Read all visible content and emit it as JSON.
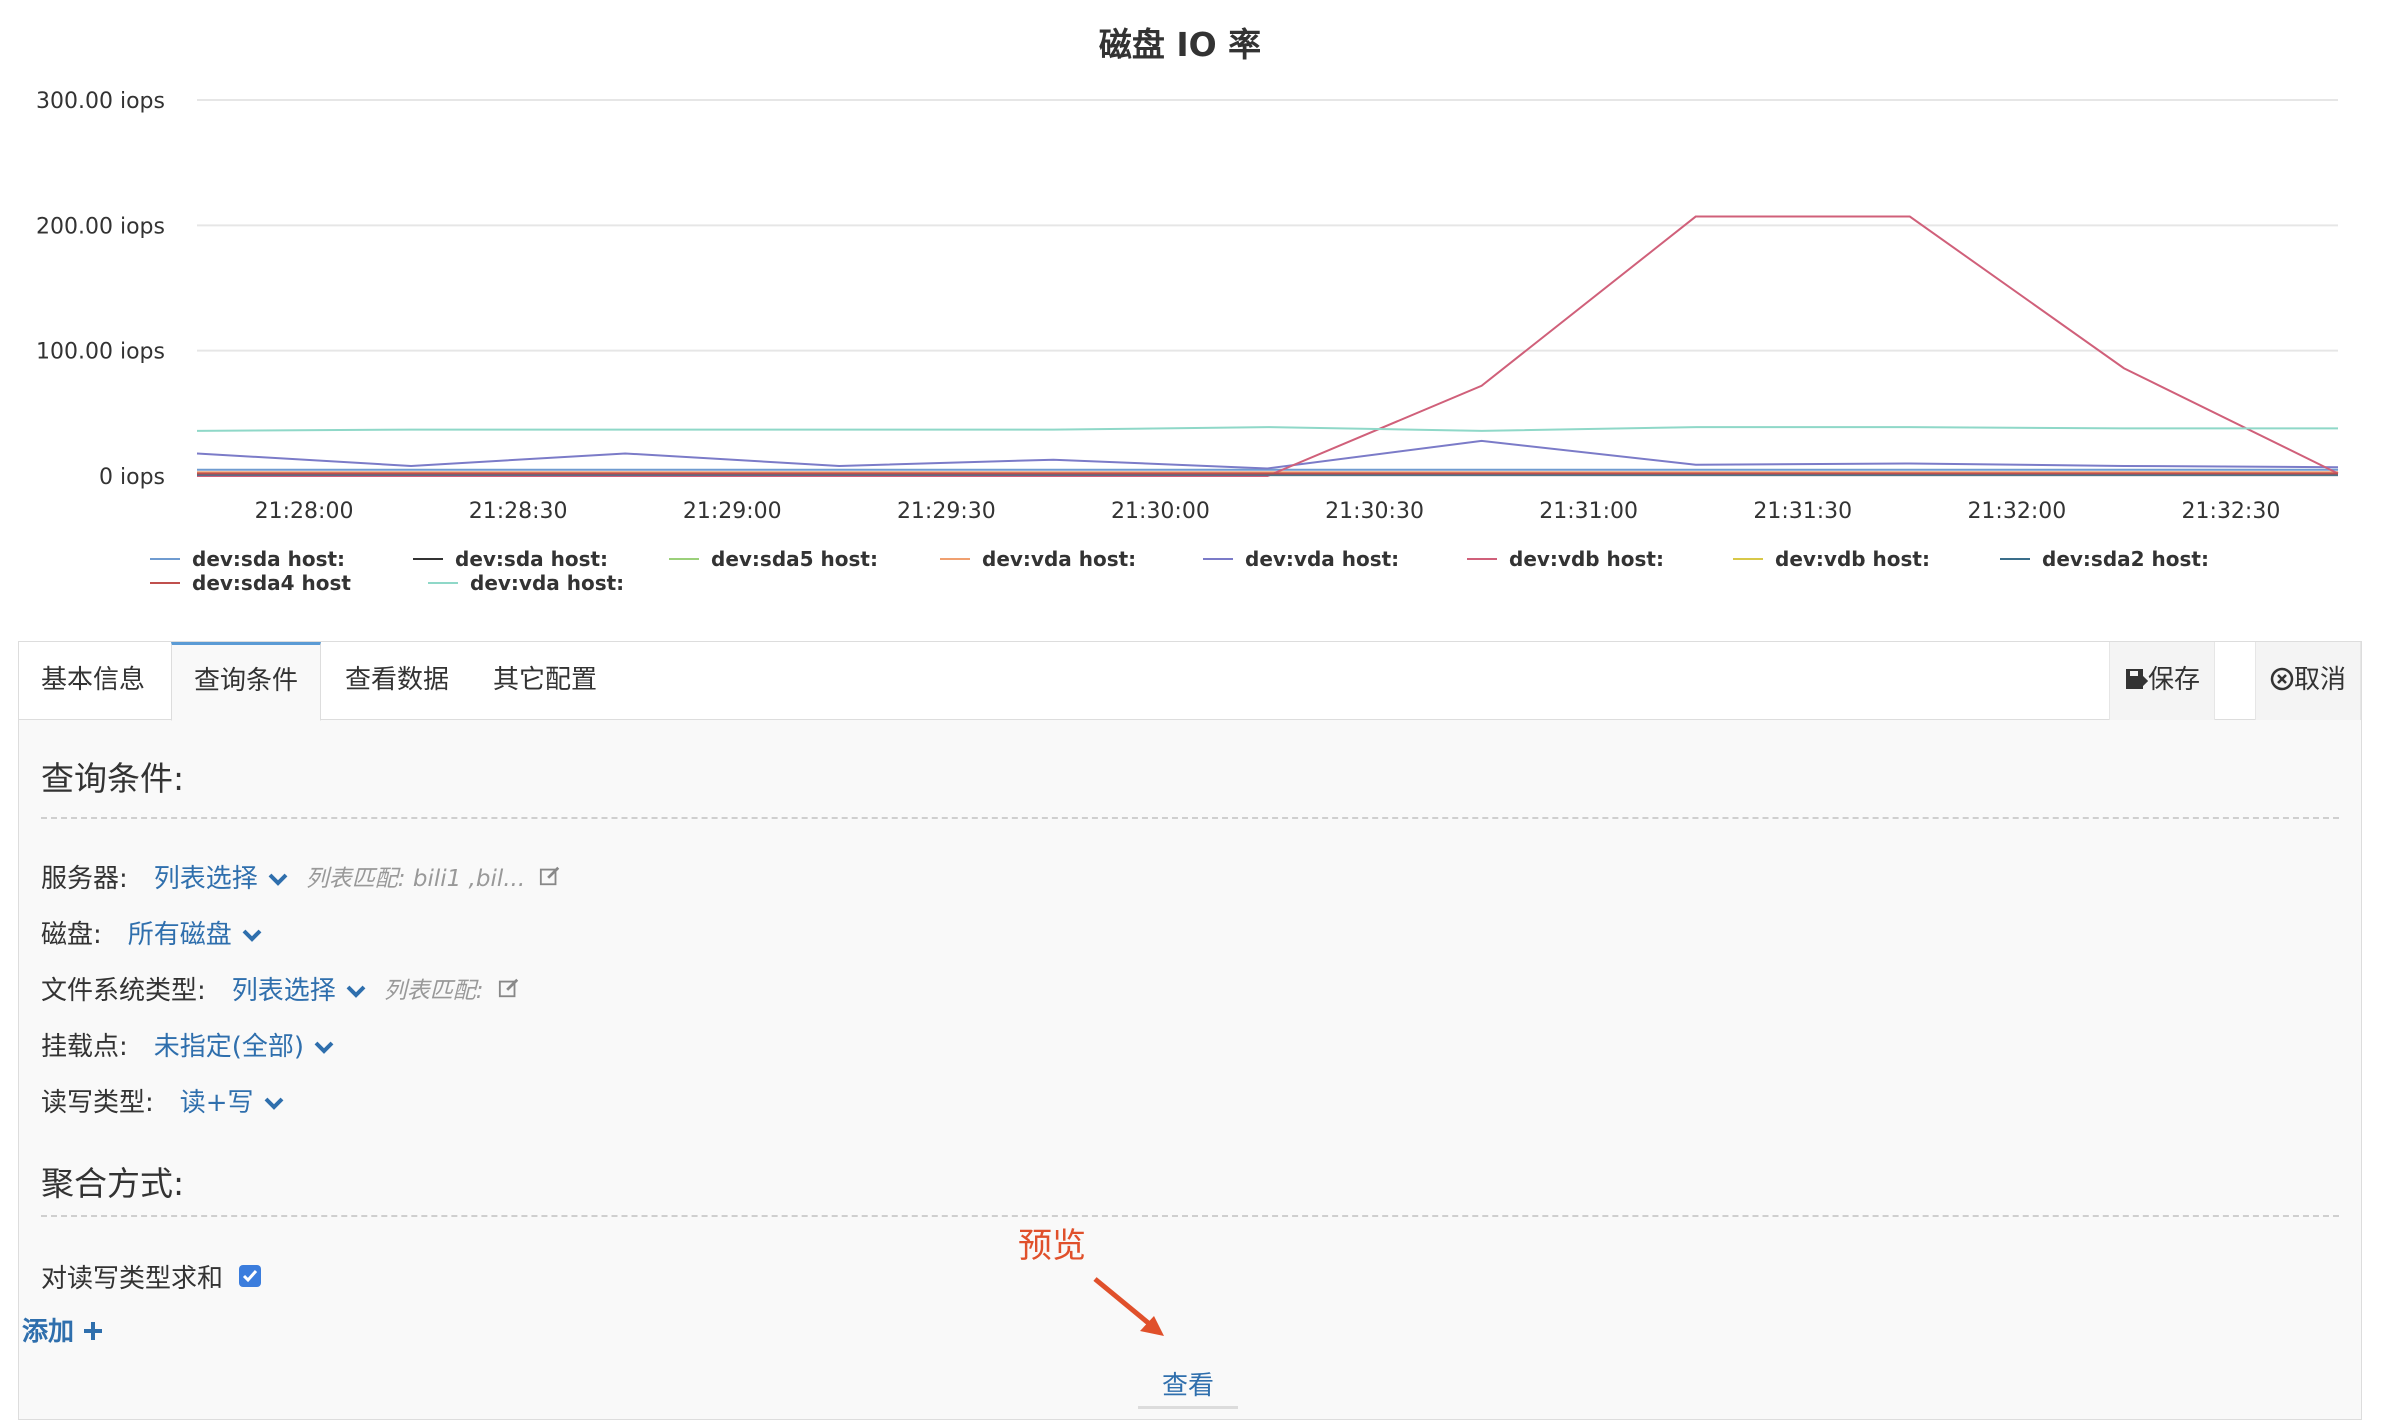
{
  "chart_title": "磁盘 IO 率",
  "chart_data": {
    "type": "line",
    "title": "磁盘 IO 率",
    "ylim": [
      0,
      300
    ],
    "y_ticks": [
      "300.00 iops",
      "200.00 iops",
      "100.00 iops",
      "0 iops"
    ],
    "x": [
      "21:27:45",
      "21:28:15",
      "21:28:45",
      "21:29:15",
      "21:29:45",
      "21:30:15",
      "21:30:45",
      "21:31:15",
      "21:31:45",
      "21:32:15",
      "21:32:45"
    ],
    "x_ticks": [
      "21:28:00",
      "21:28:30",
      "21:29:00",
      "21:29:30",
      "21:30:00",
      "21:30:30",
      "21:31:00",
      "21:31:30",
      "21:32:00",
      "21:32:30"
    ],
    "series": [
      {
        "name": "dev:sda host:",
        "color": "#6f9bd0",
        "values": [
          5,
          5,
          5,
          5,
          5,
          5,
          5,
          5,
          5,
          5,
          5
        ]
      },
      {
        "name": "dev:sda host:",
        "color": "#333333",
        "values": [
          1,
          1,
          1,
          1,
          1,
          1,
          1,
          1,
          1,
          1,
          1
        ]
      },
      {
        "name": "dev:sda5 host:",
        "color": "#9bd07a",
        "values": [
          2,
          2,
          2,
          2,
          2,
          2,
          2,
          2,
          2,
          2,
          2
        ]
      },
      {
        "name": "dev:vda host:",
        "color": "#f0a070",
        "values": [
          3,
          3,
          3,
          3,
          3,
          3,
          3,
          3,
          3,
          3,
          3
        ]
      },
      {
        "name": "dev:vda host:",
        "color": "#7b7bc8",
        "values": [
          18,
          8,
          18,
          8,
          13,
          6,
          28,
          9,
          10,
          8,
          7
        ]
      },
      {
        "name": "dev:vdb host:",
        "color": "#d0607a",
        "values": [
          0,
          0,
          0,
          0,
          0,
          0,
          72,
          207,
          207,
          86,
          2
        ]
      },
      {
        "name": "dev:vdb host:",
        "color": "#d8c848",
        "values": [
          2,
          2,
          2,
          2,
          2,
          2,
          2,
          2,
          2,
          2,
          2
        ]
      },
      {
        "name": "dev:sda2 host:",
        "color": "#3a6e8a",
        "values": [
          1,
          1,
          1,
          1,
          1,
          1,
          1,
          1,
          1,
          1,
          1
        ]
      },
      {
        "name": "dev:sda4 host",
        "color": "#c0504d",
        "values": [
          2,
          2,
          2,
          2,
          2,
          2,
          2,
          2,
          2,
          2,
          2
        ]
      },
      {
        "name": "dev:vda host:",
        "color": "#8fd8c8",
        "values": [
          36,
          37,
          37,
          37,
          37,
          39,
          36,
          39,
          39,
          38,
          38
        ]
      }
    ]
  },
  "tabs": [
    {
      "label": "基本信息"
    },
    {
      "label": "查询条件"
    },
    {
      "label": "查看数据"
    },
    {
      "label": "其它配置"
    }
  ],
  "toolbar": {
    "save_label": "保存",
    "cancel_label": "取消"
  },
  "query": {
    "section_title": "查询条件:",
    "server_label": "服务器:",
    "server_value": "列表选择",
    "server_hint": "列表匹配: bili1 ,bil...",
    "disk_label": "磁盘:",
    "disk_value": "所有磁盘",
    "fs_label": "文件系统类型:",
    "fs_value": "列表选择",
    "fs_hint": "列表匹配:",
    "mount_label": "挂载点:",
    "mount_value": "未指定(全部)",
    "rw_label": "读写类型:",
    "rw_value": "读+写"
  },
  "aggregate": {
    "section_title": "聚合方式:",
    "sum_label": "对读写类型求和",
    "sum_checked": true,
    "add_label": "添加"
  },
  "actions": {
    "view_label": "查看"
  },
  "annotation": {
    "preview_label": "预览",
    "color": "#e0502b"
  }
}
